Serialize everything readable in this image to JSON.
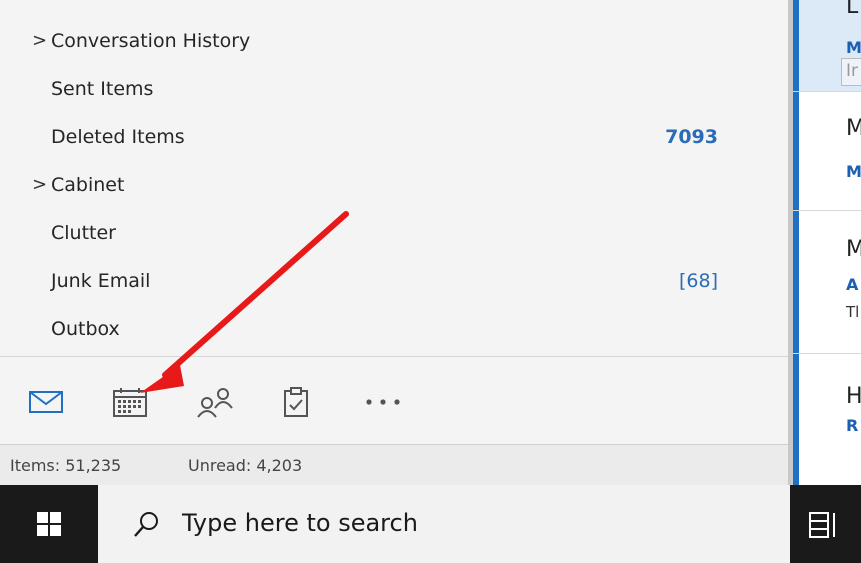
{
  "folders": [
    {
      "label": "Conversation History",
      "chevron": ">",
      "count": ""
    },
    {
      "label": "Sent Items",
      "chevron": "",
      "count": ""
    },
    {
      "label": "Deleted Items",
      "chevron": "",
      "count": "7093"
    },
    {
      "label": "Cabinet",
      "chevron": ">",
      "count": ""
    },
    {
      "label": "Clutter",
      "chevron": "",
      "count": ""
    },
    {
      "label": "Junk Email",
      "chevron": "",
      "count": "[68]"
    },
    {
      "label": "Outbox",
      "chevron": "",
      "count": ""
    }
  ],
  "nav": [
    {
      "name": "mail-icon"
    },
    {
      "name": "calendar-icon"
    },
    {
      "name": "people-icon"
    },
    {
      "name": "tasks-icon"
    },
    {
      "name": "more-icon",
      "label": "..."
    }
  ],
  "status": {
    "items": "Items: 51,235",
    "unread": "Unread: 4,203"
  },
  "messages": [
    {
      "t1": "L",
      "t2": "M",
      "t3": "Ir"
    },
    {
      "t1": "M",
      "t2": "M",
      "t3": ""
    },
    {
      "t1": "M",
      "t2": "A",
      "t3": "Tl"
    },
    {
      "t1": "H",
      "t2": "R",
      "t3": ""
    }
  ],
  "taskbar": {
    "search_placeholder": "Type here to search"
  },
  "colors": {
    "accent": "#1f6fc4",
    "count_blue": "#2b6cb8",
    "arrow_red": "#e81919",
    "taskbar": "#1a1a1a"
  }
}
